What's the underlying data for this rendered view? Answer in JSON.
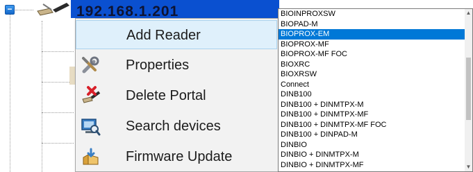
{
  "tree": {
    "toggle_glyph": "−",
    "node_label": "192.168.1.201"
  },
  "context_menu": {
    "items": [
      {
        "label": "Add Reader",
        "icon": "none",
        "highlighted": true
      },
      {
        "label": "Properties",
        "icon": "tools-icon",
        "highlighted": false
      },
      {
        "label": "Delete Portal",
        "icon": "delete-portal-icon",
        "highlighted": false
      },
      {
        "label": "Search devices",
        "icon": "search-devices-icon",
        "highlighted": false
      },
      {
        "label": "Firmware Update",
        "icon": "firmware-update-icon",
        "highlighted": false
      }
    ]
  },
  "dropdown": {
    "selected": "BIOPROX-EM",
    "items": [
      "BIOINPROXSW",
      "BIOPAD-M",
      "BIOPROX-EM",
      "BIOPROX-MF",
      "BIOPROX-MF FOC",
      "BIOXRC",
      "BIOXRSW",
      "Connect",
      "DINB100",
      "DINB100 + DINMTPX-M",
      "DINB100 + DINMTPX-MF",
      "DINB100 + DINMTPX-MF FOC",
      "DINB100 + DINPAD-M",
      "DINBIO",
      "DINBIO + DINMTPX-M",
      "DINBIO + DINMTPX-MF"
    ],
    "scroll_up_glyph": "▲",
    "scroll_down_glyph": "▼"
  },
  "colors": {
    "selection": "#0078d7",
    "node_highlight": "#0a50d0",
    "menu_hover": "#dff0fb"
  }
}
